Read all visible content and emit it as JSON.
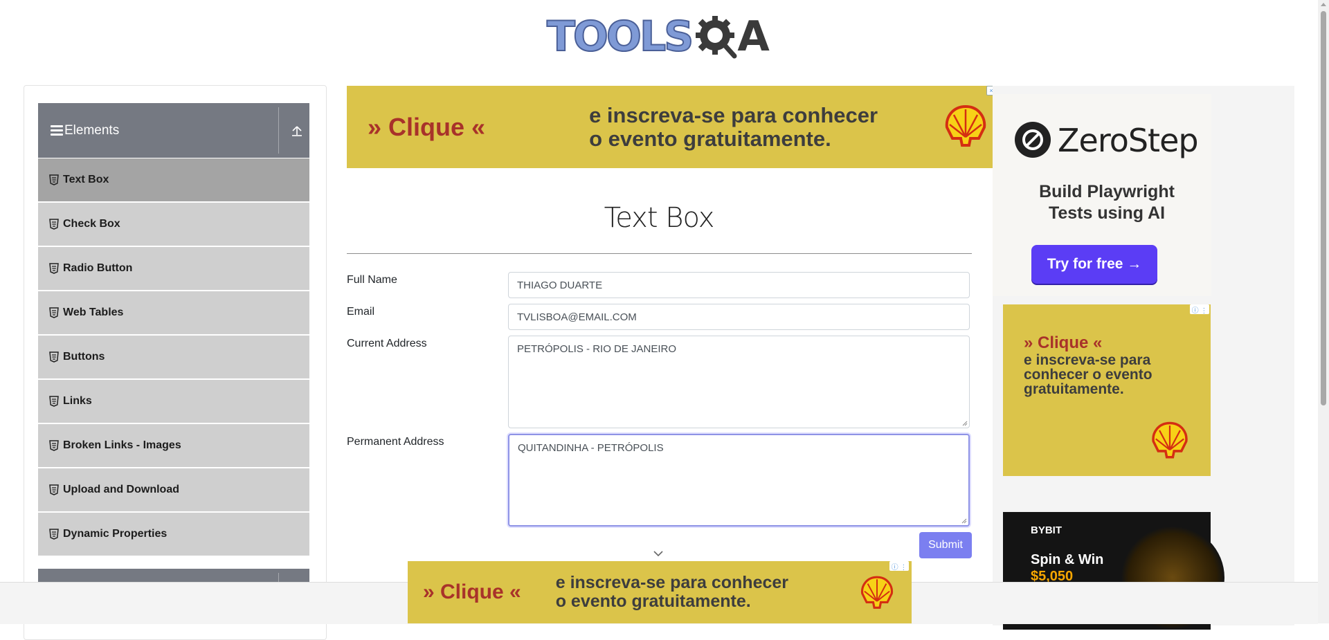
{
  "header": {
    "logo_text_left": "TOOLS",
    "logo_text_right": "A"
  },
  "sidebar": {
    "group_title": "Elements",
    "items": [
      {
        "label": "Text Box",
        "active": true
      },
      {
        "label": "Check Box"
      },
      {
        "label": "Radio Button"
      },
      {
        "label": "Web Tables"
      },
      {
        "label": "Buttons"
      },
      {
        "label": "Links"
      },
      {
        "label": "Broken Links - Images"
      },
      {
        "label": "Upload and Download"
      },
      {
        "label": "Dynamic Properties"
      }
    ]
  },
  "ad_top": {
    "cta": "» Clique «",
    "line1": "e inscreva-se para conhecer",
    "line2": "o evento gratuitamente."
  },
  "main": {
    "title": "Text Box",
    "form": {
      "full_name_label": "Full Name",
      "full_name_value": "THIAGO DUARTE",
      "email_label": "Email",
      "email_value": "TVLISBOA@EMAIL.COM",
      "current_address_label": "Current Address",
      "current_address_value": "PETRÓPOLIS - RIO DE JANEIRO",
      "permanent_address_label": "Permanent Address",
      "permanent_address_value": "QUITANDINHA - PETRÓPOLIS",
      "submit_label": "Submit"
    }
  },
  "ad_zerostep": {
    "brand": "ZeroStep",
    "tagline_1": "Build Playwright",
    "tagline_2": "Tests using AI",
    "cta": "Try for free →"
  },
  "ad_side": {
    "cta": "» Clique «",
    "text": "e inscreva-se para conhecer o evento gratuitamente."
  },
  "ad_bybit": {
    "brand": "BYBIT",
    "line1": "Spin & Win",
    "amount": "$5,050"
  },
  "ad_bottom": {
    "cta": "» Clique «",
    "line1": "e inscreva-se para conhecer",
    "line2": "o evento gratuitamente."
  },
  "colors": {
    "sidebar_header": "#757982",
    "submit": "#7b7ff0",
    "ad_yellow": "#dbc44a",
    "zerostep_button": "#5b3df5"
  }
}
